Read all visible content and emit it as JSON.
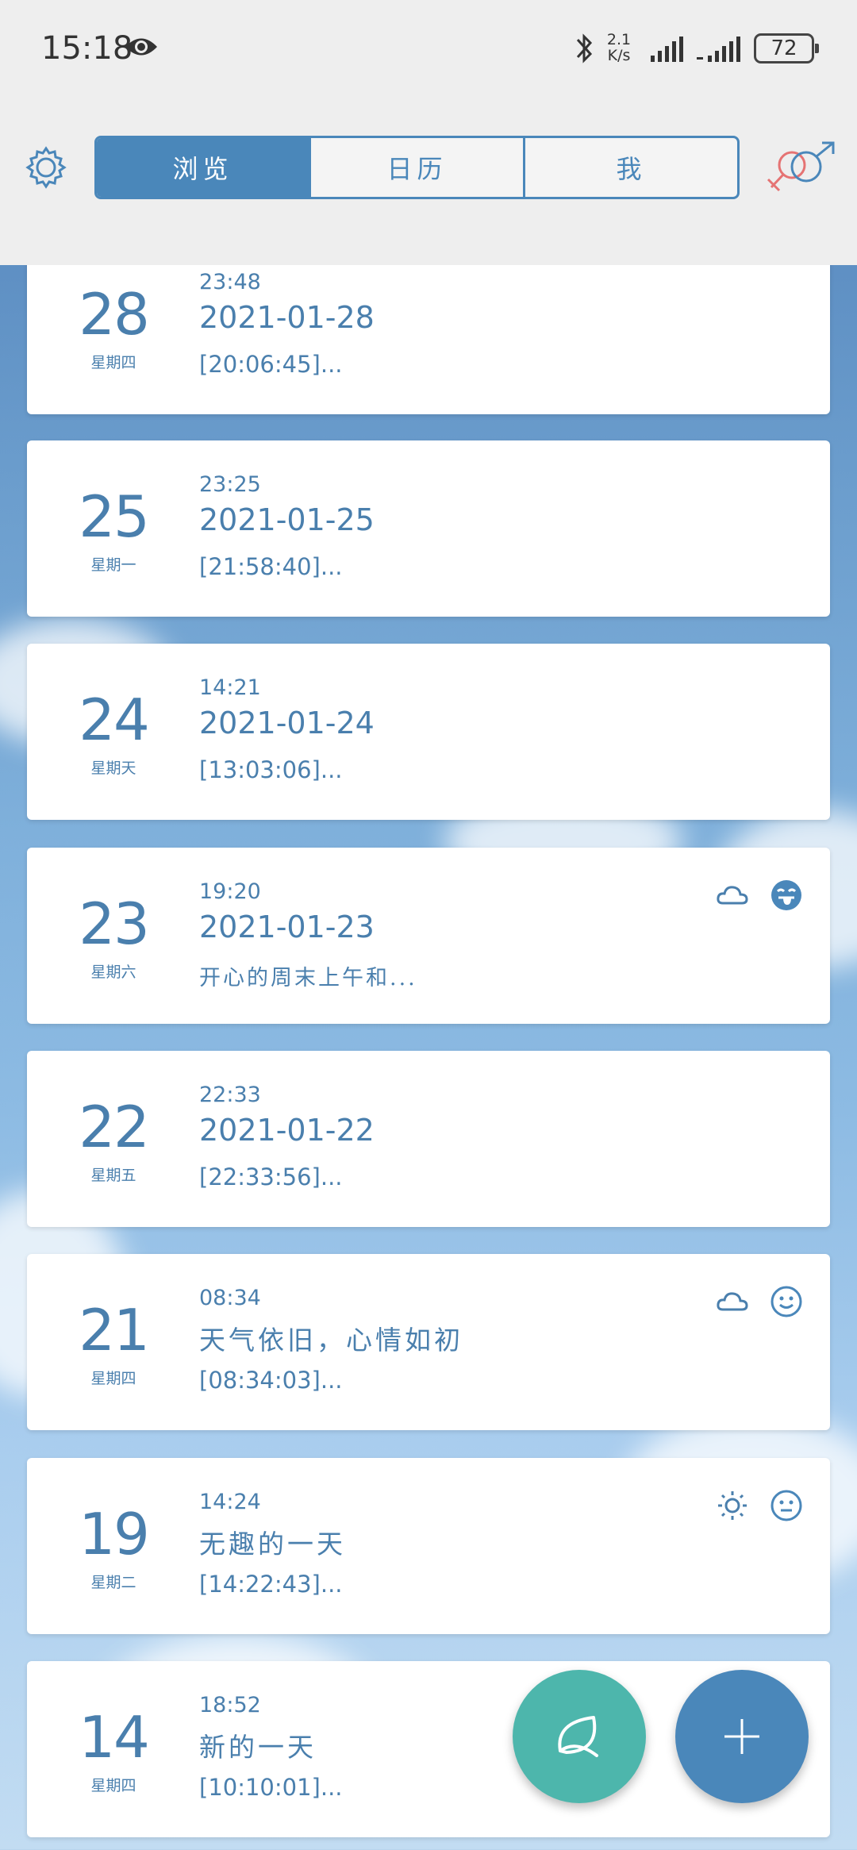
{
  "status_bar": {
    "time": "15:18",
    "net_speed_value": "2.1",
    "net_speed_unit": "K/s",
    "battery": "72"
  },
  "header": {
    "tabs": [
      {
        "label": "浏览",
        "active": true
      },
      {
        "label": "日历",
        "active": false
      },
      {
        "label": "我",
        "active": false
      }
    ]
  },
  "entries": [
    {
      "day": "28",
      "weekday": "星期四",
      "time": "23:48",
      "title": "2021-01-28",
      "preview": "[20:06:45]...",
      "weather": "",
      "mood": ""
    },
    {
      "day": "25",
      "weekday": "星期一",
      "time": "23:25",
      "title": "2021-01-25",
      "preview": "[21:58:40]...",
      "weather": "",
      "mood": ""
    },
    {
      "day": "24",
      "weekday": "星期天",
      "time": "14:21",
      "title": "2021-01-24",
      "preview": "[13:03:06]...",
      "weather": "",
      "mood": ""
    },
    {
      "day": "23",
      "weekday": "星期六",
      "time": "19:20",
      "title": "2021-01-23",
      "preview": "开心的周末上午和...",
      "weather": "cloud-icon",
      "mood": "tongue-face-icon"
    },
    {
      "day": "22",
      "weekday": "星期五",
      "time": "22:33",
      "title": "2021-01-22",
      "preview": "[22:33:56]...",
      "weather": "",
      "mood": ""
    },
    {
      "day": "21",
      "weekday": "星期四",
      "time": "08:34",
      "title": "天气依旧，心情如初",
      "preview": "[08:34:03]...",
      "weather": "cloud-icon",
      "mood": "smile-face-icon"
    },
    {
      "day": "19",
      "weekday": "星期二",
      "time": "14:24",
      "title": "无趣的一天",
      "preview": "[14:22:43]...",
      "weather": "sun-icon",
      "mood": "neutral-face-icon"
    },
    {
      "day": "14",
      "weekday": "星期四",
      "time": "18:52",
      "title": "新的一天",
      "preview": "[10:10:01]...",
      "weather": "",
      "mood": ""
    }
  ],
  "colors": {
    "accent": "#4a87ba",
    "fab_leaf": "#4db6ac",
    "text": "#4a7fad"
  }
}
